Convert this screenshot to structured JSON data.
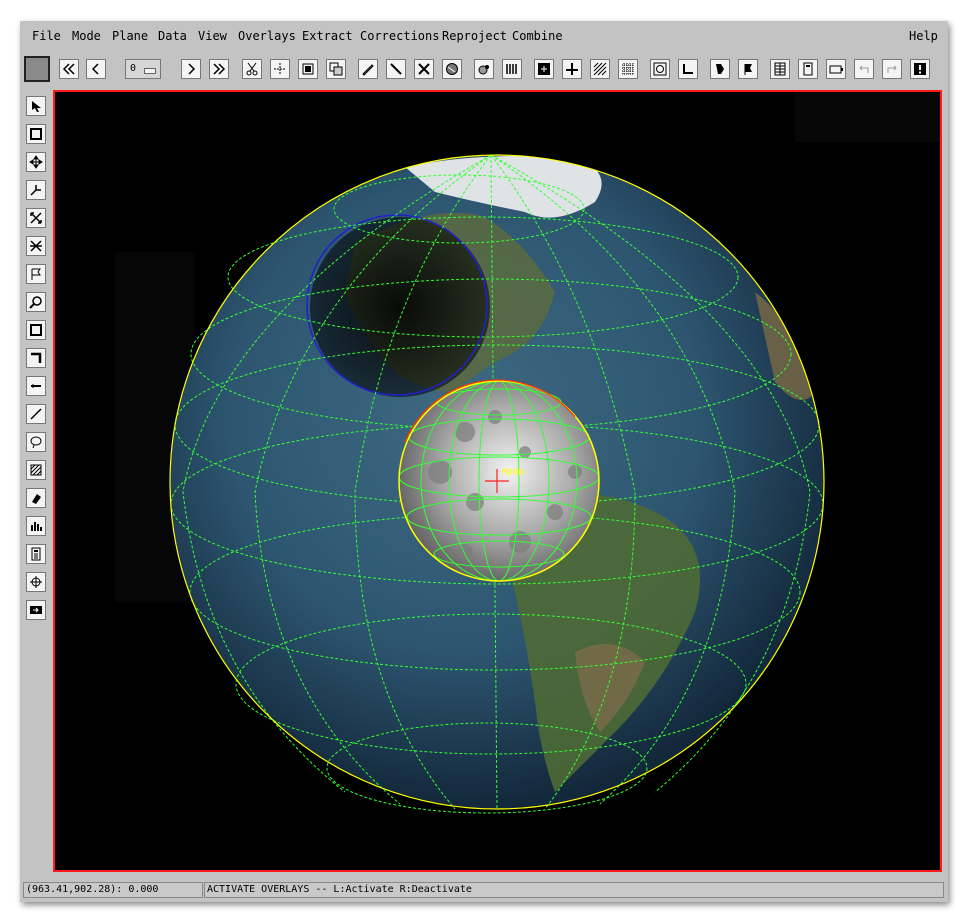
{
  "menu": {
    "file": "File",
    "mode": "Mode",
    "plane": "Plane",
    "data": "Data",
    "view": "View",
    "overlays": "Overlays",
    "extract": "Extract",
    "corrections": "Corrections",
    "reproject": "Reproject",
    "combine": "Combine",
    "help": "Help"
  },
  "toolbar": {
    "zoom_value": "0"
  },
  "canvas": {
    "marker_label": "MOON"
  },
  "status": {
    "coordinates": "(963.41,902.28): 0.000",
    "message": "ACTIVATE OVERLAYS -- L:Activate R:Deactivate"
  },
  "colors": {
    "canvas_border": "#ff1a1a",
    "grid": "#33ff33",
    "outline": "#ffff00",
    "shadow_circle": "#2020cc"
  }
}
